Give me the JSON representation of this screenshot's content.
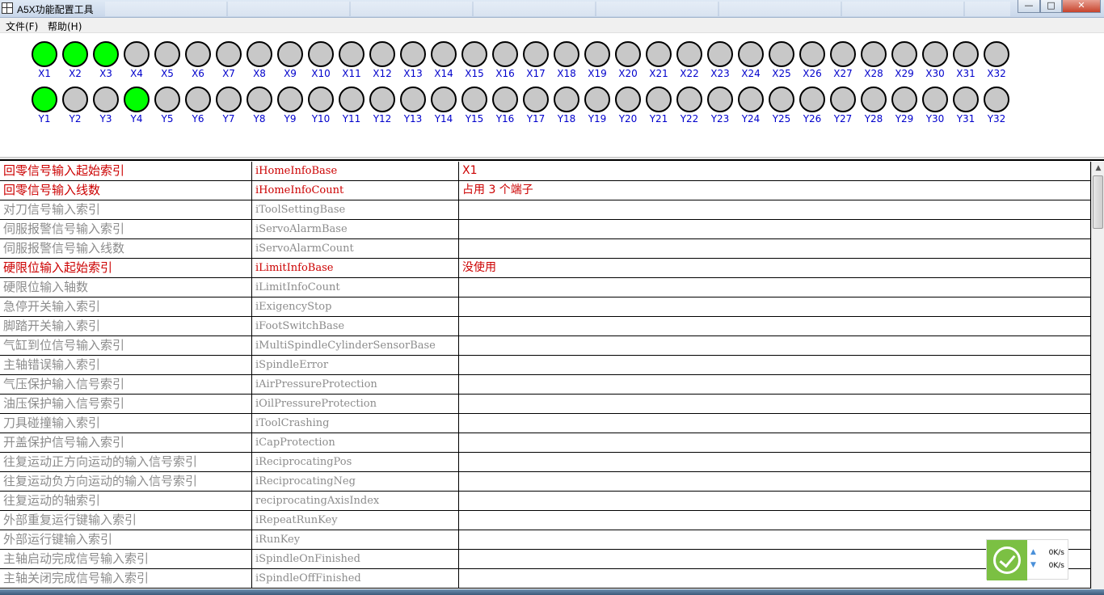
{
  "window": {
    "title": "A5X功能配置工具",
    "min": "—",
    "max": "□",
    "close": "✕"
  },
  "menu": [
    "文件(F)",
    "帮助(H)"
  ],
  "io": {
    "x": [
      {
        "label": "X1",
        "on": true
      },
      {
        "label": "X2",
        "on": true
      },
      {
        "label": "X3",
        "on": true
      },
      {
        "label": "X4",
        "on": false
      },
      {
        "label": "X5",
        "on": false
      },
      {
        "label": "X6",
        "on": false
      },
      {
        "label": "X7",
        "on": false
      },
      {
        "label": "X8",
        "on": false
      },
      {
        "label": "X9",
        "on": false
      },
      {
        "label": "X10",
        "on": false
      },
      {
        "label": "X11",
        "on": false
      },
      {
        "label": "X12",
        "on": false
      },
      {
        "label": "X13",
        "on": false
      },
      {
        "label": "X14",
        "on": false
      },
      {
        "label": "X15",
        "on": false
      },
      {
        "label": "X16",
        "on": false
      },
      {
        "label": "X17",
        "on": false
      },
      {
        "label": "X18",
        "on": false
      },
      {
        "label": "X19",
        "on": false
      },
      {
        "label": "X20",
        "on": false
      },
      {
        "label": "X21",
        "on": false
      },
      {
        "label": "X22",
        "on": false
      },
      {
        "label": "X23",
        "on": false
      },
      {
        "label": "X24",
        "on": false
      },
      {
        "label": "X25",
        "on": false
      },
      {
        "label": "X26",
        "on": false
      },
      {
        "label": "X27",
        "on": false
      },
      {
        "label": "X28",
        "on": false
      },
      {
        "label": "X29",
        "on": false
      },
      {
        "label": "X30",
        "on": false
      },
      {
        "label": "X31",
        "on": false
      },
      {
        "label": "X32",
        "on": false
      }
    ],
    "y": [
      {
        "label": "Y1",
        "on": true
      },
      {
        "label": "Y2",
        "on": false
      },
      {
        "label": "Y3",
        "on": false
      },
      {
        "label": "Y4",
        "on": true
      },
      {
        "label": "Y5",
        "on": false
      },
      {
        "label": "Y6",
        "on": false
      },
      {
        "label": "Y7",
        "on": false
      },
      {
        "label": "Y8",
        "on": false
      },
      {
        "label": "Y9",
        "on": false
      },
      {
        "label": "Y10",
        "on": false
      },
      {
        "label": "Y11",
        "on": false
      },
      {
        "label": "Y12",
        "on": false
      },
      {
        "label": "Y13",
        "on": false
      },
      {
        "label": "Y14",
        "on": false
      },
      {
        "label": "Y15",
        "on": false
      },
      {
        "label": "Y16",
        "on": false
      },
      {
        "label": "Y17",
        "on": false
      },
      {
        "label": "Y18",
        "on": false
      },
      {
        "label": "Y19",
        "on": false
      },
      {
        "label": "Y20",
        "on": false
      },
      {
        "label": "Y21",
        "on": false
      },
      {
        "label": "Y22",
        "on": false
      },
      {
        "label": "Y23",
        "on": false
      },
      {
        "label": "Y24",
        "on": false
      },
      {
        "label": "Y25",
        "on": false
      },
      {
        "label": "Y26",
        "on": false
      },
      {
        "label": "Y27",
        "on": false
      },
      {
        "label": "Y28",
        "on": false
      },
      {
        "label": "Y29",
        "on": false
      },
      {
        "label": "Y30",
        "on": false
      },
      {
        "label": "Y31",
        "on": false
      },
      {
        "label": "Y32",
        "on": false
      }
    ]
  },
  "colors": {
    "led_on": "#00ff00",
    "led_off": "#c8c8c8",
    "io_label": "#0000cc",
    "active_text": "#cc0000",
    "inactive_text": "#8c8c8c"
  },
  "config_rows": [
    {
      "name": "回零信号输入起始索引",
      "key": "iHomeInfoBase",
      "value": "X1",
      "active": true
    },
    {
      "name": "回零信号输入线数",
      "key": "iHomeInfoCount",
      "value": "占用 3 个端子",
      "active": true
    },
    {
      "name": "对刀信号输入索引",
      "key": "iToolSettingBase",
      "value": "",
      "active": false
    },
    {
      "name": "伺服报警信号输入索引",
      "key": "iServoAlarmBase",
      "value": "",
      "active": false
    },
    {
      "name": "伺服报警信号输入线数",
      "key": "iServoAlarmCount",
      "value": "",
      "active": false
    },
    {
      "name": "硬限位输入起始索引",
      "key": "iLimitInfoBase",
      "value": "没使用",
      "active": true
    },
    {
      "name": "硬限位输入轴数",
      "key": "iLimitInfoCount",
      "value": "",
      "active": false
    },
    {
      "name": "急停开关输入索引",
      "key": "iExigencyStop",
      "value": "",
      "active": false
    },
    {
      "name": "脚踏开关输入索引",
      "key": "iFootSwitchBase",
      "value": "",
      "active": false
    },
    {
      "name": "气缸到位信号输入索引",
      "key": "iMultiSpindleCylinderSensorBase",
      "value": "",
      "active": false
    },
    {
      "name": "主轴错误输入索引",
      "key": "iSpindleError",
      "value": "",
      "active": false
    },
    {
      "name": "气压保护输入信号索引",
      "key": "iAirPressureProtection",
      "value": "",
      "active": false
    },
    {
      "name": "油压保护输入信号索引",
      "key": "iOilPressureProtection",
      "value": "",
      "active": false
    },
    {
      "name": "刀具碰撞输入索引",
      "key": "iToolCrashing",
      "value": "",
      "active": false
    },
    {
      "name": "开盖保护信号输入索引",
      "key": "iCapProtection",
      "value": "",
      "active": false
    },
    {
      "name": "往复运动正方向运动的输入信号索引",
      "key": "iReciprocatingPos",
      "value": "",
      "active": false
    },
    {
      "name": "往复运动负方向运动的输入信号索引",
      "key": "iReciprocatingNeg",
      "value": "",
      "active": false
    },
    {
      "name": "往复运动的轴索引",
      "key": "reciprocatingAxisIndex",
      "value": "",
      "active": false
    },
    {
      "name": "外部重复运行键输入索引",
      "key": "iRepeatRunKey",
      "value": "",
      "active": false
    },
    {
      "name": "外部运行键输入索引",
      "key": "iRunKey",
      "value": "",
      "active": false
    },
    {
      "name": "主轴启动完成信号输入索引",
      "key": "iSpindleOnFinished",
      "value": "",
      "active": false
    },
    {
      "name": "主轴关闭完成信号输入索引",
      "key": "iSpindleOffFinished",
      "value": "",
      "active": false
    }
  ],
  "scrollbar": {
    "up_arrow": "▲"
  },
  "net_widget": {
    "up_arrow": "▲",
    "down_arrow": "▼",
    "up_speed": "0K/s",
    "down_speed": "0K/s",
    "icon": "check-circle-icon"
  }
}
